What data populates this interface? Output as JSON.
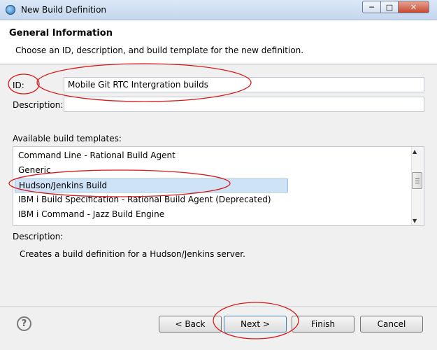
{
  "window": {
    "title": "New Build Definition",
    "minimize_glyph": "─",
    "maximize_glyph": "□",
    "close_glyph": "✕"
  },
  "header": {
    "section_title": "General Information",
    "section_description": "Choose an ID, description, and build template for the new definition."
  },
  "form": {
    "id_label": "ID:",
    "id_value": "Mobile Git RTC Intergration builds",
    "description_label": "Description:",
    "description_value": "",
    "templates_label": "Available build templates:",
    "templates": [
      "Command Line - Rational Build Agent",
      "Generic",
      "Hudson/Jenkins Build",
      "IBM i Build Specification - Rational Build Agent (Deprecated)",
      "IBM i Command - Jazz Build Engine"
    ],
    "selected_template_index": 2
  },
  "template_description": {
    "heading": "Description:",
    "text": "Creates a build definition for a Hudson/Jenkins server."
  },
  "footer": {
    "help_glyph": "?",
    "back_label": "< Back",
    "next_label": "Next >",
    "finish_label": "Finish",
    "cancel_label": "Cancel"
  },
  "colors": {
    "annotation": "#d81b1b",
    "selection": "#cfe3f7"
  }
}
